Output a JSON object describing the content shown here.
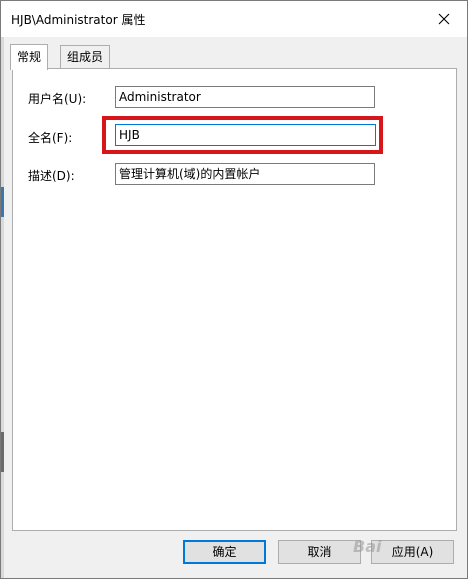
{
  "window": {
    "title": "HJB\\Administrator 属性"
  },
  "tabs": [
    {
      "label": "常规",
      "active": true
    },
    {
      "label": "组成员",
      "active": false
    }
  ],
  "fields": {
    "username": {
      "label": "用户名(U):",
      "value": "Administrator"
    },
    "fullname": {
      "label": "全名(F):",
      "value": "HJB"
    },
    "description": {
      "label": "描述(D):",
      "value": "管理计算机(域)的内置帐户"
    }
  },
  "buttons": {
    "ok": "确定",
    "cancel": "取消",
    "apply": "应用(A)"
  },
  "watermark": "Bai",
  "colors": {
    "accent": "#0078d7",
    "highlight": "#d6161b"
  }
}
